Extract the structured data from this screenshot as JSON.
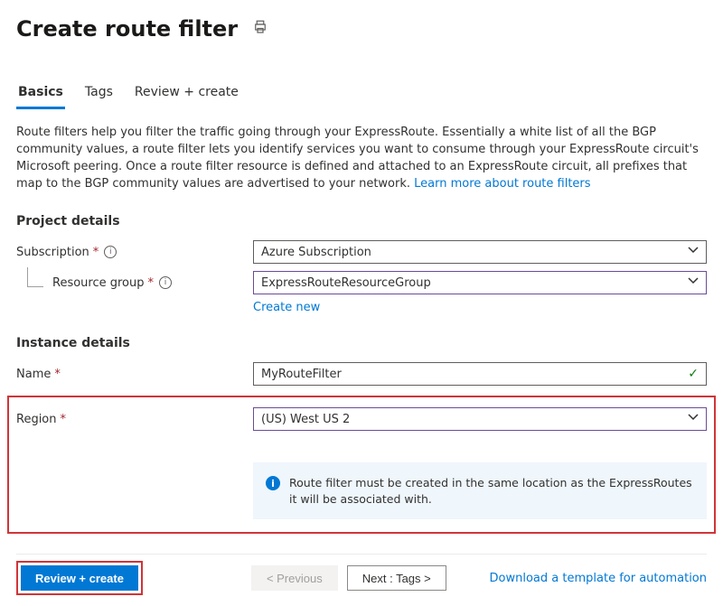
{
  "header": {
    "title": "Create route filter"
  },
  "tabs": [
    {
      "label": "Basics",
      "active": true
    },
    {
      "label": "Tags",
      "active": false
    },
    {
      "label": "Review + create",
      "active": false
    }
  ],
  "description": "Route filters help you filter the traffic going through your ExpressRoute. Essentially a white list of all the BGP community values, a route filter lets you identify services you want to consume through your ExpressRoute circuit's Microsoft peering. Once a route filter resource is defined and attached to an ExpressRoute circuit, all prefixes that map to the BGP community values are advertised to your network.  ",
  "learn_more": "Learn more about route filters",
  "project_details": {
    "section": "Project details",
    "subscription_label": "Subscription",
    "subscription_value": "Azure Subscription",
    "resource_group_label": "Resource group",
    "resource_group_value": "ExpressRouteResourceGroup",
    "create_new": "Create new"
  },
  "instance_details": {
    "section": "Instance details",
    "name_label": "Name",
    "name_value": "MyRouteFilter",
    "region_label": "Region",
    "region_value": "(US) West US 2",
    "info_text": "Route filter must be created in the same location as the ExpressRoutes it will be associated with."
  },
  "footer": {
    "review_create": "Review + create",
    "previous": "< Previous",
    "next": "Next : Tags >",
    "download": "Download a template for automation"
  }
}
